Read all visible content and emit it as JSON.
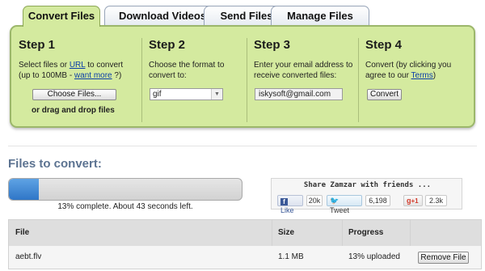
{
  "tabs": [
    {
      "label": "Convert Files",
      "active": true
    },
    {
      "label": "Download Videos",
      "active": false
    },
    {
      "label": "Send Files",
      "active": false
    },
    {
      "label": "Manage Files",
      "active": false
    }
  ],
  "steps": {
    "step1": {
      "title": "Step 1",
      "text_before_url": "Select files or ",
      "url_link": "URL",
      "text_after_url": " to convert",
      "text_line2": "(up to 100MB - ",
      "want_more_link": "want more",
      "text_line2_end": " ?)",
      "button": "Choose Files...",
      "drag_text": "or drag and drop files"
    },
    "step2": {
      "title": "Step 2",
      "text": "Choose the format to convert to:",
      "format_value": "gif"
    },
    "step3": {
      "title": "Step 3",
      "text": "Enter your email address to receive converted files:",
      "email_value": "iskysoft@gmail.com"
    },
    "step4": {
      "title": "Step 4",
      "text_before": "Convert (by clicking you agree to our ",
      "terms_link": "Terms",
      "text_after": ")",
      "button": "Convert"
    }
  },
  "files_title": "Files to convert:",
  "progress": {
    "percent": 13,
    "text": "13% complete. About 43 seconds left."
  },
  "share": {
    "title": "Share Zamzar with friends ...",
    "facebook_label": "Like",
    "facebook_count": "20k",
    "twitter_label": "Tweet",
    "twitter_count": "6,198",
    "gplus_label": "+1",
    "gplus_count": "2.3k"
  },
  "table": {
    "headers": [
      "File",
      "Size",
      "Progress",
      ""
    ],
    "rows": [
      {
        "file": "aebt.flv",
        "size": "1.1 MB",
        "progress": "13% uploaded",
        "action": "Remove File"
      }
    ]
  },
  "colors": {
    "panel_green": "#d4ea9f",
    "progress_blue": "#2f76c7",
    "title_blue": "#5c7391"
  }
}
